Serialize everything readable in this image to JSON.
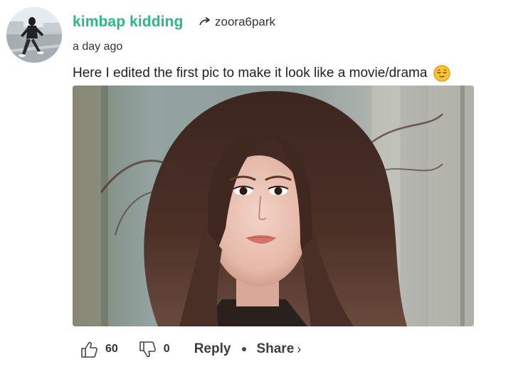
{
  "comment": {
    "author": "kimbap kidding",
    "reply_to_user": "zoora6park",
    "timestamp": "a day ago",
    "text": "Here I edited the first pic to make it look like a movie/drama",
    "emoji": "relieved-face-emoji"
  },
  "actions": {
    "likes": "60",
    "dislikes": "0",
    "reply_label": "Reply",
    "share_label": "Share",
    "share_chevron": "›"
  },
  "icons": {
    "like": "thumbs-up-icon",
    "dislike": "thumbs-down-icon",
    "reply_arrow": "reply-arrow-icon"
  },
  "colors": {
    "author_accent": "#2db883",
    "text": "#1f1f1f",
    "muted": "#333333"
  }
}
